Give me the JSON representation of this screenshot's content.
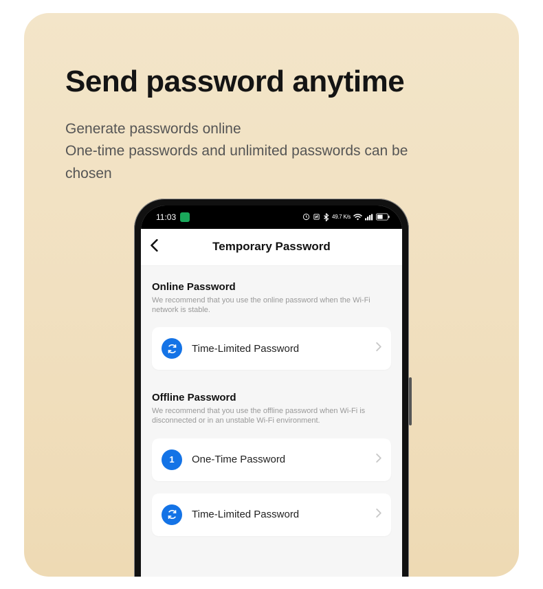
{
  "hero": {
    "title": "Send password anytime",
    "subtitle": "Generate passwords online\nOne-time passwords and unlimited passwords can be chosen"
  },
  "statusbar": {
    "time": "11:03",
    "extra": "49.7 K/s"
  },
  "appbar": {
    "title": "Temporary Password"
  },
  "sections": {
    "online": {
      "heading": "Online Password",
      "desc": "We recommend that you use the online password when the Wi-Fi network is stable.",
      "items": [
        {
          "kind": "sync",
          "label": "Time-Limited Password"
        }
      ]
    },
    "offline": {
      "heading": "Offline Password",
      "desc": "We recommend that you use the offline password when Wi-Fi is disconnected or in an unstable Wi-Fi environment.",
      "items": [
        {
          "kind": "one",
          "label": "One-Time Password"
        },
        {
          "kind": "sync",
          "label": "Time-Limited Password"
        }
      ]
    }
  }
}
